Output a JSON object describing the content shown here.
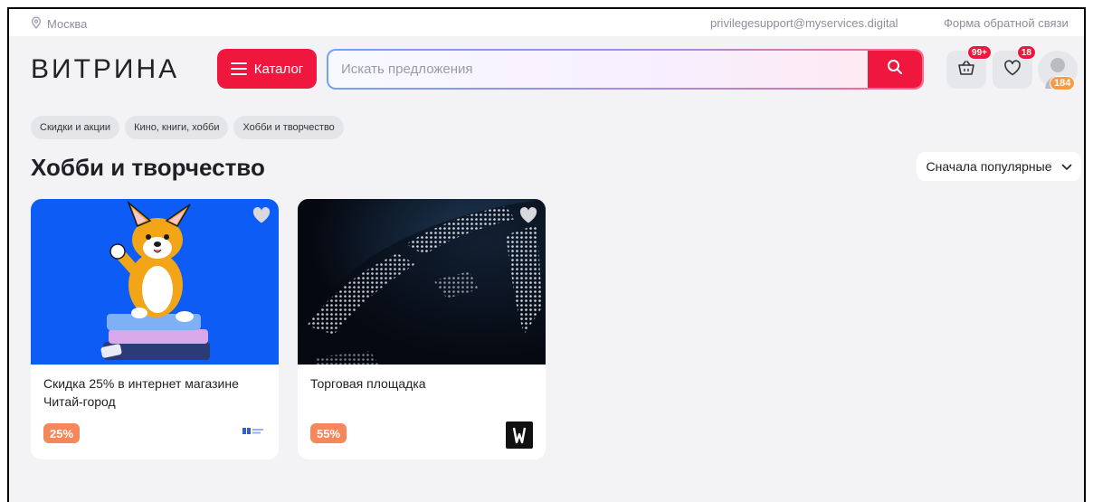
{
  "topbar": {
    "city": "Москва",
    "email": "privilegesupport@myservices.digital",
    "feedback": "Форма обратной связи"
  },
  "header": {
    "logo": "ВИТРИНА",
    "catalog_label": "Каталог",
    "search_placeholder": "Искать предложения",
    "cart_badge": "99+",
    "favorites_badge": "18",
    "points": "184"
  },
  "breadcrumbs": [
    "Скидки и акции",
    "Кино, книги, хобби",
    "Хобби и творчество"
  ],
  "page": {
    "title": "Хобби и творчество",
    "sort_label": "Сначала популярные"
  },
  "cards": [
    {
      "title": "Скидка 25% в интернет магазине Читай-город",
      "discount": "25%"
    },
    {
      "title": "Торговая площадка",
      "discount": "55%"
    }
  ],
  "colors": {
    "accent": "#f0173f",
    "discount": "#f5875a",
    "card1_bg": "#0d5cf5",
    "card2_bg": "#0b1220"
  }
}
